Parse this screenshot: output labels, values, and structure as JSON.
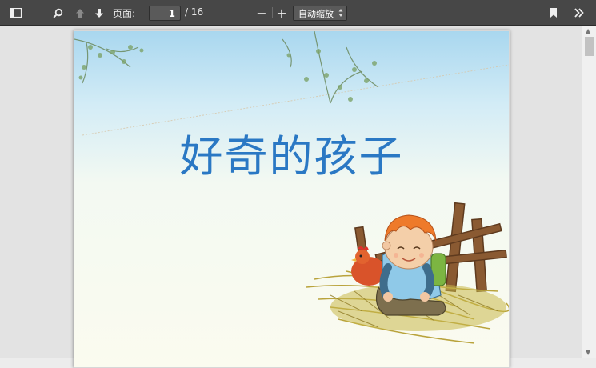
{
  "toolbar": {
    "page_label": "页面:",
    "page_number": "1",
    "page_total": "/ 16",
    "zoom_value": "自动缩放",
    "zoom_minus": "−",
    "zoom_plus": "+"
  },
  "document": {
    "title": "好奇的孩子"
  },
  "colors": {
    "toolbar_bg": "#474747",
    "title": "#2a78c4"
  }
}
